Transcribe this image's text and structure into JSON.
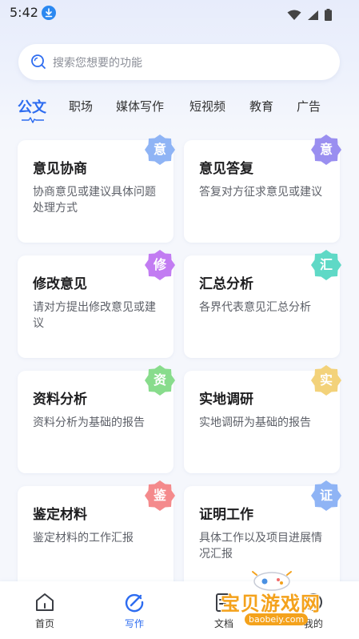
{
  "status_bar": {
    "time": "5:42"
  },
  "search": {
    "placeholder": "搜索您想要的功能"
  },
  "tabs": [
    {
      "label": "公文",
      "active": true
    },
    {
      "label": "职场"
    },
    {
      "label": "媒体写作"
    },
    {
      "label": "短视频"
    },
    {
      "label": "教育"
    },
    {
      "label": "广告"
    }
  ],
  "cards": [
    {
      "title": "意见协商",
      "desc": "协商意见或建议具体问题处理方式",
      "badge": "意",
      "badge_color": "#8fb4f5"
    },
    {
      "title": "意见答复",
      "desc": "答复对方征求意见或建议",
      "badge": "意",
      "badge_color": "#9a8ff0"
    },
    {
      "title": "修改意见",
      "desc": "请对方提出修改意见或建议",
      "badge": "修",
      "badge_color": "#c27cf2"
    },
    {
      "title": "汇总分析",
      "desc": "各界代表意见汇总分析",
      "badge": "汇",
      "badge_color": "#5fd9c6"
    },
    {
      "title": "资料分析",
      "desc": "资料分析为基础的报告",
      "badge": "资",
      "badge_color": "#88dc8c"
    },
    {
      "title": "实地调研",
      "desc": "实地调研为基础的报告",
      "badge": "实",
      "badge_color": "#f3d27a"
    },
    {
      "title": "鉴定材料",
      "desc": "鉴定材料的工作汇报",
      "badge": "鉴",
      "badge_color": "#f48a8c"
    },
    {
      "title": "证明工作",
      "desc": "具体工作以及项目进展情况汇报",
      "badge": "证",
      "badge_color": "#8fb4f5"
    }
  ],
  "nav": [
    {
      "label": "首页",
      "icon": "home-icon"
    },
    {
      "label": "写作",
      "icon": "write-icon",
      "active": true
    },
    {
      "label": "文档",
      "icon": "document-icon"
    },
    {
      "label": "我的",
      "icon": "profile-icon"
    }
  ],
  "watermark": {
    "text": "宝贝游戏网",
    "url": "baobeiy.com"
  },
  "colors": {
    "accent": "#2d6cf0"
  }
}
